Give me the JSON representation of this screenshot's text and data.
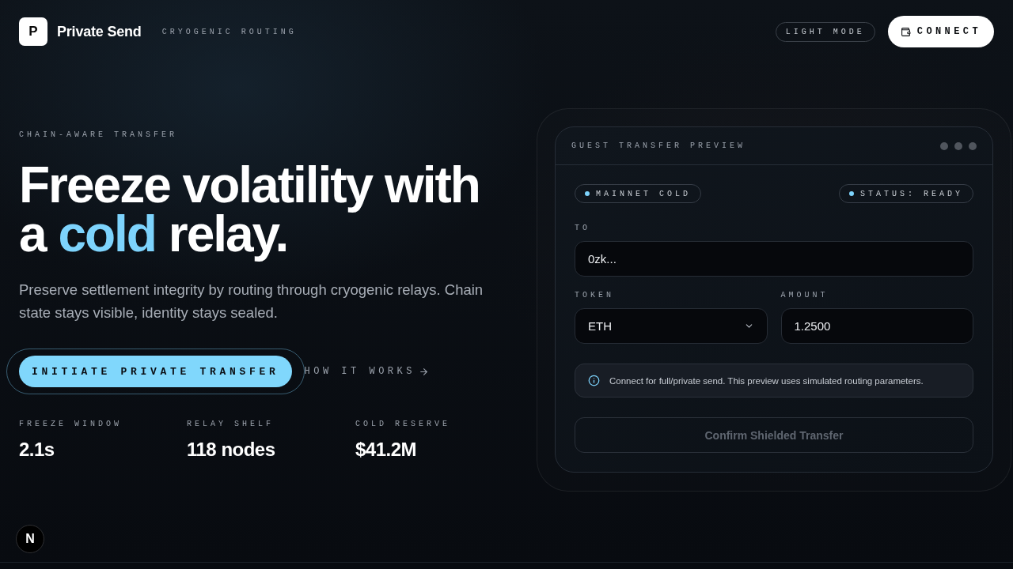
{
  "header": {
    "logo_letter": "P",
    "brand": "Private Send",
    "tagline": "CRYOGENIC ROUTING",
    "theme_toggle": "LIGHT MODE",
    "connect_button": "CONNECT"
  },
  "hero": {
    "eyebrow": "CHAIN-AWARE TRANSFER",
    "heading": [
      {
        "text": "Freeze volatility with a ",
        "highlight": false
      },
      {
        "text": "cold",
        "highlight": true
      },
      {
        "text": " relay.",
        "highlight": false
      }
    ],
    "description": "Preserve settlement integrity by routing through cryogenic relays. Chain state stays visible, identity stays sealed.",
    "primary_button": "INITIATE PRIVATE TRANSFER",
    "secondary_link": "HOW IT WORKS",
    "stats": [
      {
        "label": "FREEZE WINDOW",
        "value": "2.1s"
      },
      {
        "label": "RELAY SHELF",
        "value": "118 nodes"
      },
      {
        "label": "COLD RESERVE",
        "value": "$41.2M"
      }
    ]
  },
  "card": {
    "title": "GUEST TRANSFER PREVIEW",
    "badges": [
      "MAINNET COLD",
      "STATUS: READY"
    ],
    "recipient": {
      "label": "TO",
      "value": "0zk..."
    },
    "token": {
      "label": "TOKEN",
      "value": "ETH"
    },
    "amount": {
      "label": "AMOUNT",
      "value": "1.2500"
    },
    "notice": "Connect for full/private send. This preview uses simulated routing parameters.",
    "confirm_button": {
      "label": "Confirm Shielded Transfer",
      "disabled": true
    }
  },
  "dev_badge": "N"
}
